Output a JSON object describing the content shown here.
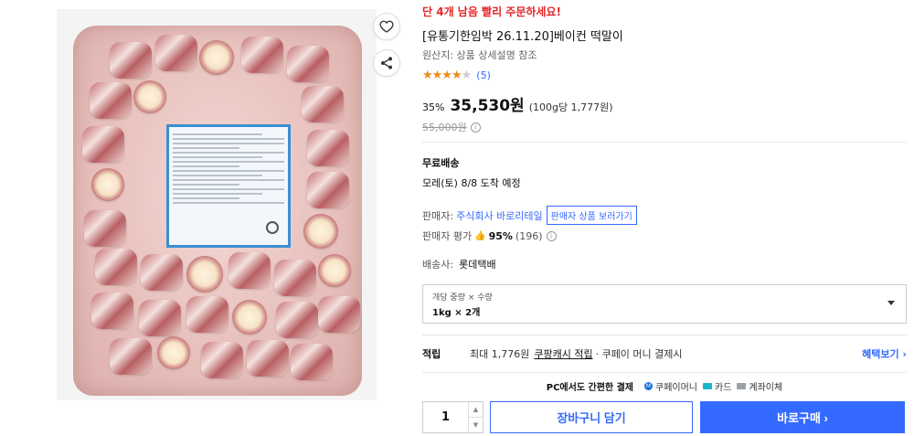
{
  "product": {
    "urgency": "단 4개 남음 빨리 주문하세요!",
    "title": "[유통기한임박 26.11.20]베이컨 떡말이",
    "origin": "원산지: 상품 상세설명 참조",
    "rating_stars": 4,
    "review_count": "(5)",
    "discount": "35%",
    "sale_price": "35,530원",
    "unit_price": "(100g당 1,777원)",
    "original_price": "55,000원",
    "info_icon_glyph": "i"
  },
  "shipping": {
    "label": "무료배송",
    "arrival": "모레(토) 8/8 도착 예정"
  },
  "seller": {
    "key": "판매자:",
    "name": "주식회사 바로리테일",
    "link": "판매자 상품 보러가기",
    "rating_key": "판매자 평가",
    "rating_value": "95%",
    "rating_count": "(196)",
    "courier_key": "배송사:",
    "courier_value": "롯데택배"
  },
  "option": {
    "label": "개당 중량 × 수량",
    "value": "1kg × 2개"
  },
  "points": {
    "key": "적립",
    "text_prefix": "최대 1,776원",
    "link": "쿠팡캐시 적립",
    "text_suffix": "· 쿠페이 머니 결제시",
    "benefit": "혜택보기 ›"
  },
  "payment": {
    "title": "PC에서도 간편한 결제",
    "methods": [
      "쿠페이머니",
      "카드",
      "계좌이체"
    ]
  },
  "purchase": {
    "quantity": "1",
    "cart_label": "장바구니 담기",
    "buy_label": "바로구매 ›"
  },
  "icons": {
    "heart": "heart-icon",
    "share": "share-icon",
    "star": "star-icon",
    "thumb": "thumb-up-icon",
    "caret": "chevron-down-icon"
  }
}
